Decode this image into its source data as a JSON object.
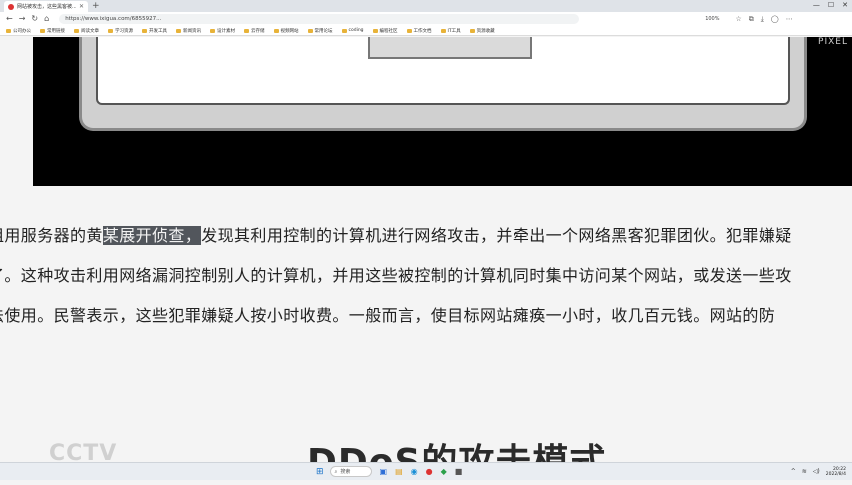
{
  "browser": {
    "tab_title": "网站被攻击，这些黑客被...",
    "url": "https://www.ixigua.com/6855927...",
    "zoom": "100%",
    "bookmarks": [
      "公司办公",
      "常用链接",
      "阅读文章",
      "学习资源",
      "开发工具",
      "新闻资讯",
      "设计素材",
      "云存储",
      "视频网站",
      "常用论坛",
      "coding",
      "编程社区",
      "工作文档",
      "IT工具",
      "资源收藏"
    ]
  },
  "video": {
    "watermark": "PIXEL"
  },
  "article": {
    "line1_before": "租用服务器的黄",
    "line1_highlight": "某展开侦查，",
    "line1_after": "发现其利用控制的计算机进行网络攻击，并牵出一个网络黑客犯罪团伙。犯罪嫌疑",
    "line2": "了。这种攻击利用网络漏洞控制别人的计算机，并用这些被控制的计算机同时集中访问某个网站，或发送一些攻",
    "line3": "法使用。民警表示，这些犯罪嫌疑人按小时收费。一般而言，使目标网站瘫痪一小时，收几百元钱。网站的防"
  },
  "subtitle": "DDoS的攻击模式",
  "logo": "CCTV",
  "taskbar": {
    "search_label": "搜索",
    "time": "20:22",
    "date": "2022/8/4"
  },
  "colors": {
    "highlight_bg": "#52565c",
    "page_bg": "#f4f4f4"
  }
}
